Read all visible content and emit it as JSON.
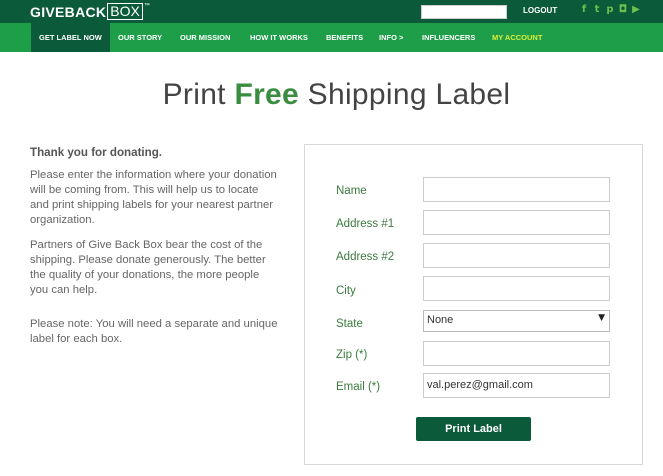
{
  "header": {
    "logo_part1": "GIVEBACK",
    "logo_part2": "BOX",
    "logo_tm": "™",
    "logout_label": "LOGOUT",
    "social_icons": [
      "facebook-icon",
      "twitter-icon",
      "pinterest-icon",
      "instagram-icon",
      "youtube-icon"
    ],
    "social_glyphs": [
      "f",
      "t",
      "p",
      "◘",
      "▶"
    ]
  },
  "nav": {
    "items": [
      {
        "label": "GET LABEL NOW"
      },
      {
        "label": "OUR STORY"
      },
      {
        "label": "OUR MISSION"
      },
      {
        "label": "HOW IT WORKS"
      },
      {
        "label": "BENEFITS"
      },
      {
        "label": "INFO >"
      },
      {
        "label": "INFLUENCERS"
      },
      {
        "label": "MY ACCOUNT"
      }
    ]
  },
  "title": {
    "part1": "Print ",
    "part2": "Free",
    "part3": " Shipping Label"
  },
  "intro": {
    "thanks": "Thank you for donating.",
    "para1": "Please enter the information where your donation will be coming from. This will help us to locate and print shipping labels for your nearest partner organization.",
    "para2": "Partners of Give Back Box bear the cost of the shipping. Please donate generously. The better the quality of your donations, the more people you can help.",
    "para3": "Please note: You will need a separate and unique label for each box."
  },
  "form": {
    "name_label": "Name",
    "name_value": "",
    "address1_label": "Address #1",
    "address1_value": "",
    "address2_label": "Address #2",
    "address2_value": "",
    "city_label": "City",
    "city_value": "",
    "state_label": "State",
    "state_value": "None",
    "zip_label": "Zip (*)",
    "zip_value": "",
    "email_label": "Email (*)",
    "email_value": "val.perez@gmail.com",
    "submit_label": "Print Label"
  },
  "colors": {
    "topbar": "#0b5a3a",
    "navbar": "#1f9e4a",
    "accent_green": "#3a8c3f",
    "highlight_yellow": "#d9ef3c"
  }
}
